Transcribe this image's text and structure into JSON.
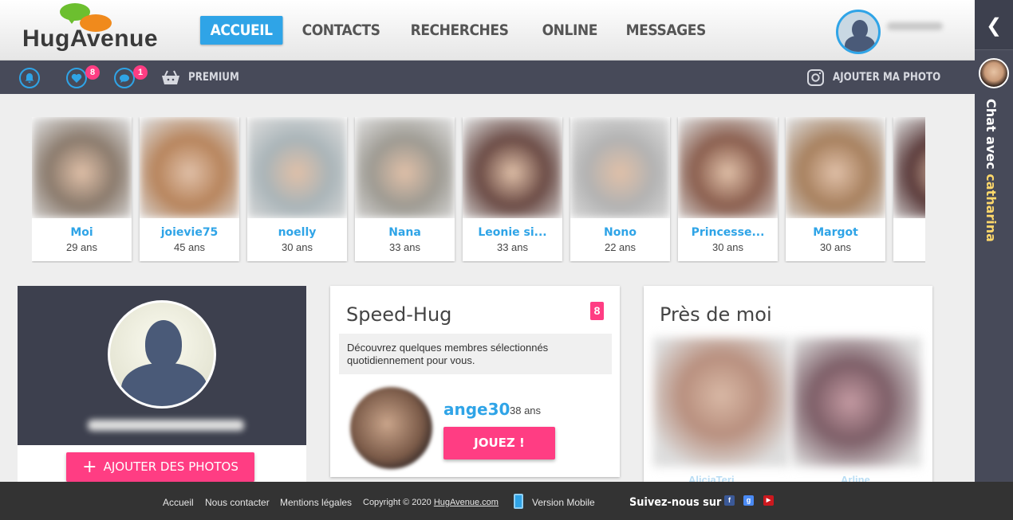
{
  "header": {
    "logo_text": "HugAvenue",
    "nav": [
      {
        "label": "ACCUEIL",
        "active": true
      },
      {
        "label": "CONTACTS",
        "active": false
      },
      {
        "label": "RECHERCHES",
        "active": false
      },
      {
        "label": "ONLINE",
        "active": false
      },
      {
        "label": "MESSAGES",
        "active": false
      }
    ]
  },
  "subbar": {
    "likes_badge": "8",
    "messages_badge": "1",
    "premium_label": "PREMIUM",
    "add_photo_label": "AJOUTER MA PHOTO"
  },
  "chat": {
    "prefix": "Chat avec",
    "username": "catharina"
  },
  "members": [
    {
      "name": "Moi",
      "age": "29 ans",
      "tone": "#8a7a6c"
    },
    {
      "name": "joievie75",
      "age": "45 ans",
      "tone": "#b7845c"
    },
    {
      "name": "noelly",
      "age": "30 ans",
      "tone": "#a9b4b8"
    },
    {
      "name": "Nana",
      "age": "33 ans",
      "tone": "#9d9a92"
    },
    {
      "name": "Leonie si...",
      "age": "33 ans",
      "tone": "#6a4a44"
    },
    {
      "name": "Nono",
      "age": "22 ans",
      "tone": "#b2b2b2"
    },
    {
      "name": "Princesse...",
      "age": "30 ans",
      "tone": "#8a5e4e"
    },
    {
      "name": "Margot",
      "age": "30 ans",
      "tone": "#a7805e"
    },
    {
      "name": "",
      "age": "",
      "tone": "#5a3a3a"
    }
  ],
  "profile": {
    "add_photos_label": "AJOUTER DES PHOTOS"
  },
  "speedhug": {
    "title": "Speed-Hug",
    "count": "8",
    "description": "Découvrez quelques membres sélectionnés quotidiennement pour vous.",
    "username": "ange30",
    "age": "38 ans",
    "play_label": "JOUEZ !"
  },
  "nearme": {
    "title": "Près de moi",
    "names": [
      "AliciaTeri",
      "Arline"
    ]
  },
  "footer": {
    "links": [
      "Accueil",
      "Nous contacter",
      "Mentions légales"
    ],
    "copyright_prefix": "Copyright © 2020",
    "copyright_link": "HugAvenue.com",
    "mobile_label": "Version Mobile",
    "follow_label": "Suivez-nous sur"
  },
  "colors": {
    "accent_blue": "#2fa4e7",
    "accent_pink": "#ff3d83",
    "dark_bar": "#474a59"
  }
}
